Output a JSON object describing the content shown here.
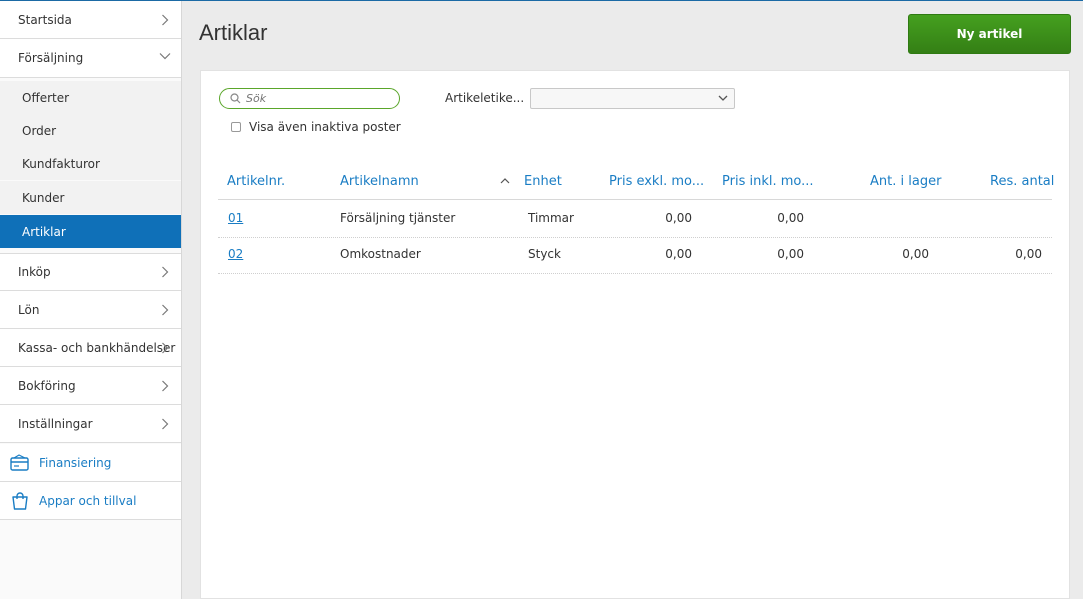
{
  "sidebar": {
    "items": [
      {
        "label": "Startsida"
      },
      {
        "label": "Försäljning"
      },
      {
        "label": "Inköp"
      },
      {
        "label": "Lön"
      },
      {
        "label": "Kassa- och bankhändelser"
      },
      {
        "label": "Bokföring"
      },
      {
        "label": "Inställningar"
      }
    ],
    "sub_items": [
      {
        "label": "Offerter"
      },
      {
        "label": "Order"
      },
      {
        "label": "Kundfakturor"
      },
      {
        "label": "Kunder"
      },
      {
        "label": "Artiklar",
        "active": true
      }
    ],
    "extras": [
      {
        "label": "Finansiering",
        "icon": "credit-card-icon"
      },
      {
        "label": "Appar och tillval",
        "icon": "shopping-bag-icon"
      }
    ]
  },
  "header": {
    "title": "Artiklar",
    "new_button_label": "Ny artikel"
  },
  "filters": {
    "search_placeholder": "Sök",
    "article_label_filter": "Artikeletike...",
    "article_label_selected": "",
    "show_inactive_label": "Visa även inaktiva poster",
    "show_inactive_checked": false
  },
  "table": {
    "columns": [
      "Artikelnr.",
      "Artikelnamn",
      "Enhet",
      "Pris exkl. mo...",
      "Pris inkl. mo...",
      "Ant. i lager",
      "Res. antal"
    ],
    "sorted_column": "Artikelnamn",
    "sort_direction": "ascending",
    "rows": [
      {
        "nr": "01",
        "name": "Försäljning tjänster",
        "unit": "Timmar",
        "price_excl": "0,00",
        "price_incl": "0,00",
        "stock": "",
        "reserved": ""
      },
      {
        "nr": "02",
        "name": "Omkostnader",
        "unit": "Styck",
        "price_excl": "0,00",
        "price_incl": "0,00",
        "stock": "0,00",
        "reserved": "0,00"
      }
    ]
  },
  "colors": {
    "accent": "#0f70b8",
    "link": "#1a7dc4",
    "primary_button": "#3a8b19"
  }
}
